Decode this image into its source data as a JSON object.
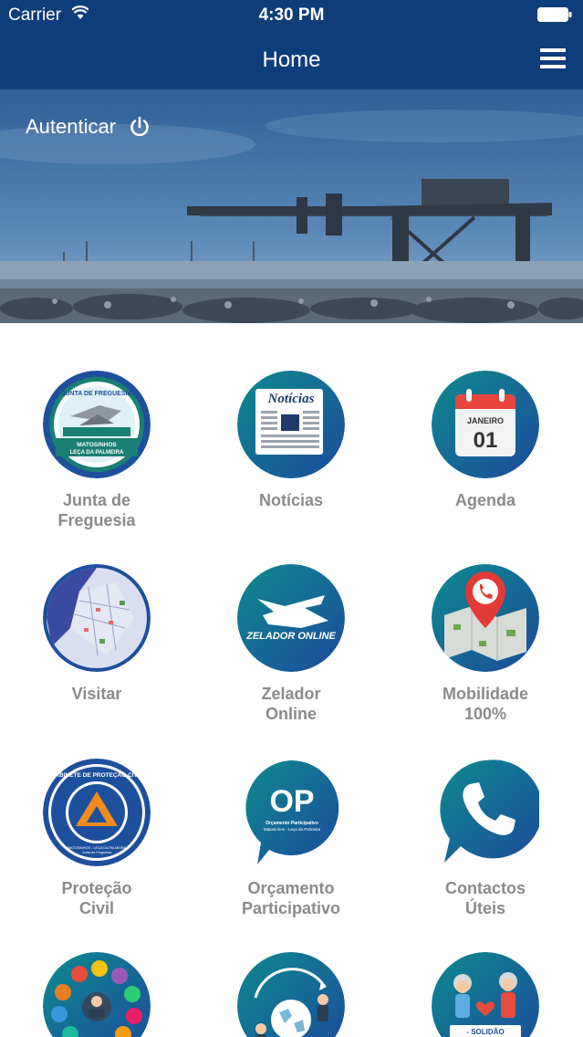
{
  "status_bar": {
    "carrier": "Carrier",
    "time": "4:30 PM"
  },
  "nav": {
    "title": "Home",
    "menu_icon": "hamburger-menu-icon"
  },
  "hero": {
    "auth_label": "Autenticar",
    "auth_icon": "power-icon"
  },
  "colors": {
    "nav_bg": "#0f3d7a",
    "circle_blue": "#1d4f9c",
    "circle_teal": "#0d8a8a",
    "label_gray": "#8a8a8a"
  },
  "tiles": [
    {
      "label": "Junta de\nFreguesia",
      "icon": "parish-seal-icon",
      "seal_top": "JUNTA DE FREGUESIA",
      "seal_bottom_1": "MATOSINHOS",
      "seal_bottom_2": "LEÇA DA PALMEIRA"
    },
    {
      "label": "Notícias",
      "icon": "newspaper-icon",
      "badge": "Notícias"
    },
    {
      "label": "Agenda",
      "icon": "calendar-icon",
      "month": "JANEIRO",
      "day": "01"
    },
    {
      "label": "Visitar",
      "icon": "map-icon"
    },
    {
      "label": "Zelador\nOnline",
      "icon": "zelador-icon",
      "badge": "ZELADOR ONLINE"
    },
    {
      "label": "Mobilidade\n100%",
      "icon": "map-pin-phone-icon"
    },
    {
      "label": "Proteção\nCivil",
      "icon": "civil-protection-icon",
      "seal_top": "GABINETE DE PROTEÇÃO CIVIL",
      "seal_bottom_1": "MATOSINHOS - LEÇA DA PALMEIRA",
      "seal_bottom_2": "Junta de Freguesia"
    },
    {
      "label": "Orçamento\nParticipativo",
      "icon": "participatory-budget-icon",
      "badge": "OP",
      "sub_1": "Orçamento Participativo",
      "sub_2": "Matosinhos - Leça da Palmeira"
    },
    {
      "label": "Contactos\nÚteis",
      "icon": "phone-icon"
    },
    {
      "label": "",
      "icon": "services-icon"
    },
    {
      "label": "",
      "icon": "globe-people-icon"
    },
    {
      "label": "",
      "icon": "solitude-icon",
      "badge": "- SOLIDÃO"
    }
  ]
}
